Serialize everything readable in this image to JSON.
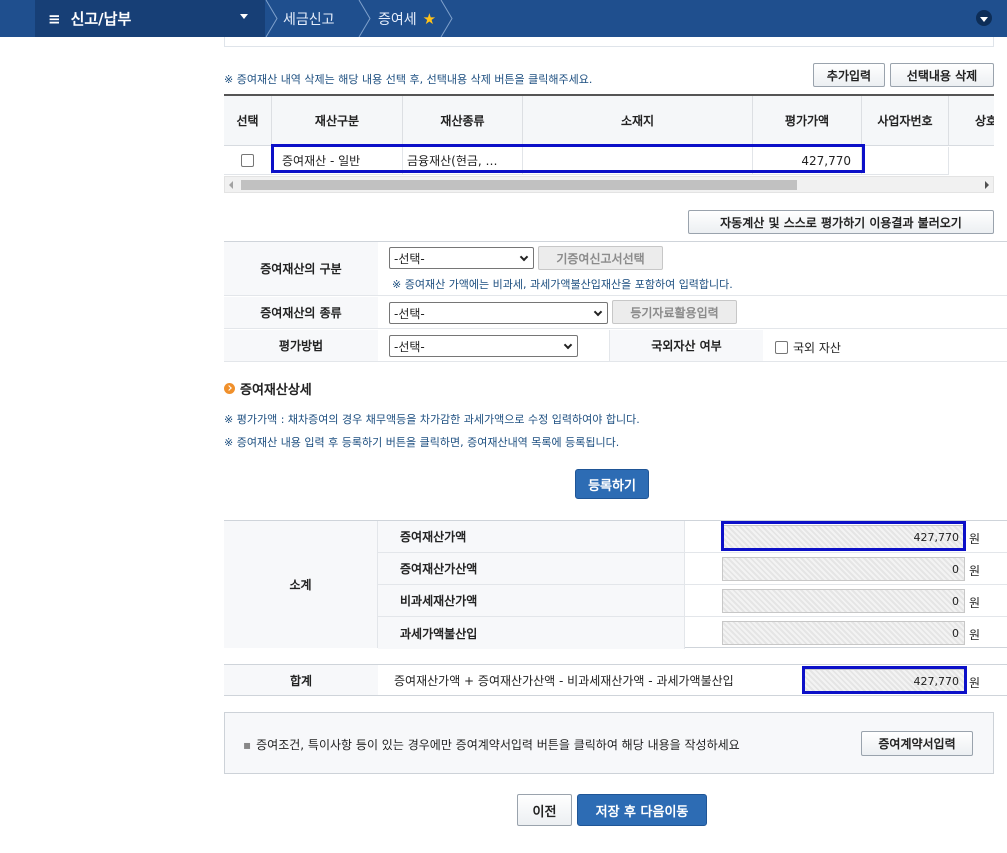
{
  "nav": {
    "menu_title": "신고/납부",
    "crumbs": [
      "세금신고",
      "증여세"
    ]
  },
  "grid": {
    "delete_note": "※ 증여재산 내역 삭제는 해당 내용 선택 후, 선택내용 삭제 버튼을  클릭해주세요.",
    "add_button": "추가입력",
    "delete_button": "선택내용 삭제",
    "headers": [
      "선택",
      "재산구분",
      "재산종류",
      "소재지",
      "평가가액",
      "사업자번호",
      "상호"
    ],
    "rows": [
      {
        "category": "증여재산 - 일반",
        "kind": "금융재산(현금, …",
        "location": "",
        "value": "427,770",
        "bizno": ""
      }
    ]
  },
  "form": {
    "load_button": "자동계산 및 스스로 평가하기 이용결과 불러오기",
    "row1_label": "증여재산의 구분",
    "row1_select": "-선택-",
    "row1_button": "기증여신고서선택",
    "row1_note": "※ 증여재산 가액에는 비과세, 과세가액불산입재산을 포함하여 입력합니다.",
    "row2_label": "증여재산의 종류",
    "row2_select": "-선택-",
    "row2_button": "등기자료활용입력",
    "row3_label": "평가방법",
    "row3_select": "-선택-",
    "foreign_label": "국외자산 여부",
    "foreign_check_label": "국외 자산"
  },
  "detail": {
    "title": "증여재산상세",
    "note1": "※ 평가가액 : 채차증여의 경우 채무액등을 차가감한 과세가액으로 수정 입력하여야 합니다.",
    "note2": "※ 증여재산 내용 입력 후 등록하기 버튼을 클릭하면, 증여재산내역 목록에 등록됩니다.",
    "register_button": "등록하기"
  },
  "summary": {
    "label": "소계",
    "rows": [
      {
        "label": "증여재산가액",
        "value": "427,770"
      },
      {
        "label": "증여재산가산액",
        "value": "0"
      },
      {
        "label": "비과세재산가액",
        "value": "0"
      },
      {
        "label": "과세가액불산입",
        "value": "0"
      }
    ],
    "unit": "원"
  },
  "total": {
    "label": "합계",
    "formula": "증여재산가액 + 증여재산가산액 - 비과세재산가액 - 과세가액불산입",
    "value": "427,770",
    "unit": "원"
  },
  "info": {
    "text": "증여조건, 특이사항 등이 있는 경우에만 증여계약서입력 버튼을 클릭하여 해당 내용을 작성하세요",
    "button": "증여계약서입력"
  },
  "footer": {
    "prev_button": "이전",
    "next_button": "저장 후 다음이동"
  }
}
